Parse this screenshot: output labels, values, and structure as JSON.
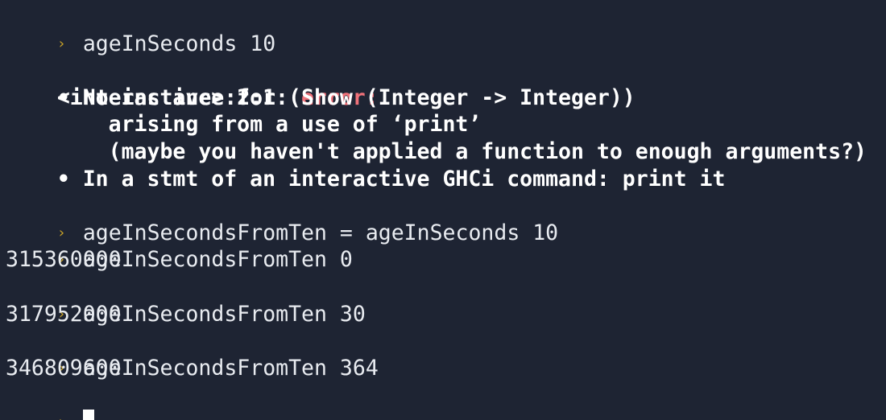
{
  "prompt_symbol": "›",
  "lines": {
    "cmd1": "ageInSeconds 10",
    "err_loc": "<interactive>:2:1: ",
    "err_label": "error:",
    "err_b1": "    • No instance for (Show (Integer -> Integer))",
    "err_b1a": "        arising from a use of ‘print’",
    "err_b1b": "        (maybe you haven't applied a function to enough arguments?)",
    "err_b2": "    • In a stmt of an interactive GHCi command: print it",
    "cmd2": "ageInSecondsFromTen = ageInSeconds 10",
    "cmd3": "ageInSecondsFromTen 0",
    "out3": "315360000",
    "cmd4": "ageInSecondsFromTen 30",
    "out4": "317952000",
    "cmd5": "ageInSecondsFromTen 364",
    "out5": "346809600"
  },
  "colors": {
    "background": "#1e2433",
    "prompt": "#c9a227",
    "error": "#f0727a",
    "text": "#e8ebf0"
  }
}
